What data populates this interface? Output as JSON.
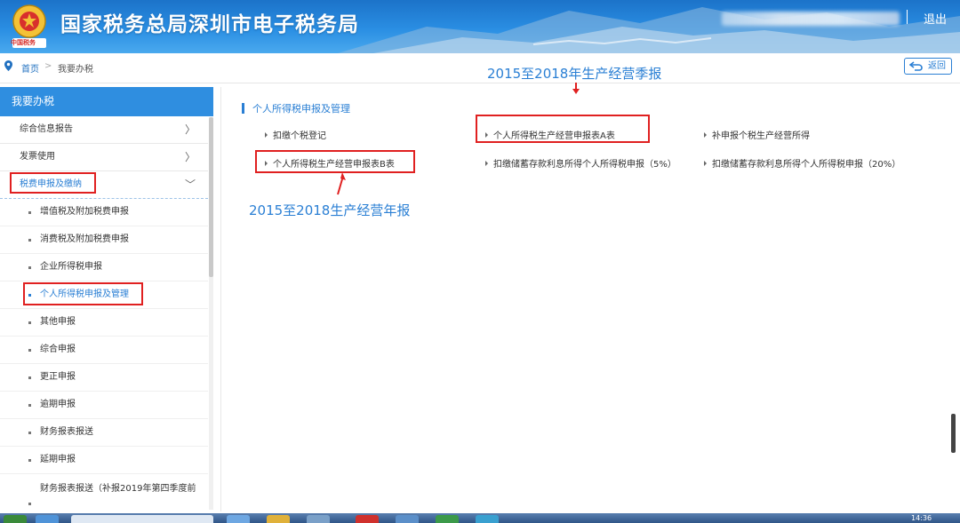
{
  "header": {
    "site_title": "国家税务总局深圳市电子税务局",
    "emblem_caption": "中国税务",
    "separator": "|",
    "logout_label": "退出"
  },
  "breadcrumb": {
    "home": "首页",
    "separator": ">",
    "current": "我要办税",
    "back_label": "返回"
  },
  "annotations": {
    "top_note": "2015至2018年生产经营季报",
    "bottom_note": "2015至2018生产经营年报"
  },
  "sidebar": {
    "title": "我要办税",
    "items": [
      {
        "label": "综合信息报告",
        "chevron": "〉"
      },
      {
        "label": "发票使用",
        "chevron": "〉"
      },
      {
        "label": "税费申报及缴纳",
        "chevron": "﹀"
      }
    ],
    "sub_items": [
      {
        "label": "增值税及附加税费申报"
      },
      {
        "label": "消费税及附加税费申报"
      },
      {
        "label": "企业所得税申报"
      },
      {
        "label": "个人所得税申报及管理"
      },
      {
        "label": "其他申报"
      },
      {
        "label": "综合申报"
      },
      {
        "label": "更正申报"
      },
      {
        "label": "逾期申报"
      },
      {
        "label": "财务报表报送"
      },
      {
        "label": "延期申报"
      },
      {
        "label": "财务报表报送（补报2019年第四季度前"
      }
    ]
  },
  "main": {
    "section_title": "个人所得税申报及管理",
    "links": [
      {
        "label": "扣缴个税登记"
      },
      {
        "label": "个人所得税生产经营申报表A表"
      },
      {
        "label": "补申报个税生产经营所得"
      },
      {
        "label": "个人所得税生产经营申报表B表"
      },
      {
        "label": "扣缴储蓄存款利息所得个人所得税申报（5%）"
      },
      {
        "label": "扣缴储蓄存款利息所得个人所得税申报（20%）"
      }
    ]
  },
  "taskbar": {
    "time": "14:36"
  },
  "colors": {
    "accent": "#2a7fd4",
    "highlight_box": "#e02020",
    "header_blue": "#1c73c9"
  }
}
